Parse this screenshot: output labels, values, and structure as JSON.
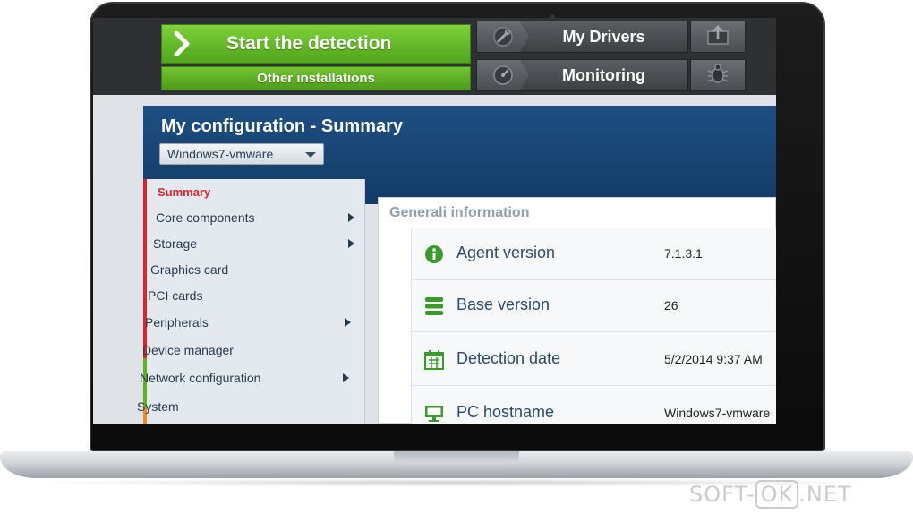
{
  "toolbar": {
    "start_detection": "Start the detection",
    "other_installations": "Other installations",
    "my_drivers": "My Drivers",
    "monitoring": "Monitoring",
    "icons": {
      "start": "chevron-right-icon",
      "drivers": "wrench-icon",
      "upload": "upload-icon",
      "monitoring": "gauge-icon",
      "bug": "bug-icon"
    }
  },
  "header": {
    "title": "My configuration - Summary",
    "machine_select": "Windows7-vmware"
  },
  "sidebar": {
    "items": [
      {
        "label": "Summary",
        "active": true,
        "has_submenu": false
      },
      {
        "label": "Core components",
        "active": false,
        "has_submenu": true
      },
      {
        "label": "Storage",
        "active": false,
        "has_submenu": true
      },
      {
        "label": "Graphics card",
        "active": false,
        "has_submenu": false
      },
      {
        "label": "PCI cards",
        "active": false,
        "has_submenu": false
      },
      {
        "label": "Peripherals",
        "active": false,
        "has_submenu": true
      },
      {
        "label": "Device manager",
        "active": false,
        "has_submenu": false
      },
      {
        "label": "Network configuration",
        "active": false,
        "has_submenu": true
      },
      {
        "label": "System",
        "active": false,
        "has_submenu": false
      }
    ]
  },
  "panel": {
    "title": "Generali information",
    "rows": [
      {
        "label": "Agent version",
        "value": "7.1.3.1",
        "icon": "info-icon"
      },
      {
        "label": "Base version",
        "value": "26",
        "icon": "database-icon"
      },
      {
        "label": "Detection date",
        "value": "5/2/2014 9:37 AM",
        "icon": "calendar-icon"
      },
      {
        "label": "PC hostname",
        "value": "Windows7-vmware",
        "icon": "monitor-icon"
      }
    ]
  },
  "watermark": {
    "part1": "SOFT-",
    "part2": "OK",
    "part3": ".NET"
  },
  "colors": {
    "accent_green": "#5bb323",
    "header_blue": "#1a4675",
    "active_red": "#d9262a",
    "icon_green": "#3a9a2a"
  }
}
